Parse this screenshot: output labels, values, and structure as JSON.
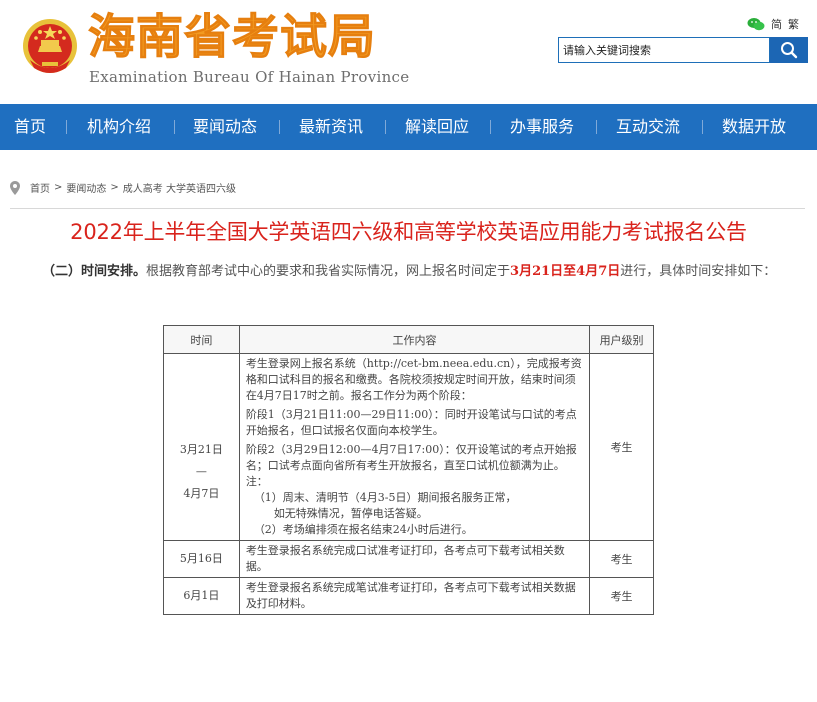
{
  "header": {
    "title_cn": "海南省考试局",
    "title_en": "Examination Bureau Of Hainan Province",
    "lang_simplified": "简",
    "lang_traditional": "繁",
    "search_placeholder": "请输入关键词搜索"
  },
  "nav": {
    "items": [
      {
        "label": "首页"
      },
      {
        "label": "机构介绍"
      },
      {
        "label": "要闻动态"
      },
      {
        "label": "最新资讯"
      },
      {
        "label": "解读回应"
      },
      {
        "label": "办事服务"
      },
      {
        "label": "互动交流"
      },
      {
        "label": "数据开放"
      }
    ]
  },
  "breadcrumb": {
    "items": [
      "首页",
      "要闻动态",
      "成人高考 大学英语四六级"
    ],
    "separator": ">"
  },
  "article": {
    "title": "2022年上半年全国大学英语四六级和高等学校英语应用能力考试报名公告",
    "para_heading": "（二）时间安排。",
    "para_text_1": "根据教育部考试中心的要求和我省实际情况，网上报名时间定于",
    "para_highlight": "3月21日至4月7日",
    "para_text_2": "进行，具体时间安排如下："
  },
  "table": {
    "headers": [
      "时间",
      "工作内容",
      "用户级别"
    ],
    "rows": [
      {
        "time_lines": [
          "3月21日",
          "—",
          "4月7日"
        ],
        "work": [
          "考生登录网上报名系统（http://cet-bm.neea.edu.cn），完成报考资格和口试科目的报名和缴费。各院校须按规定时间开放，结束时间须在4月7日17时之前。报名工作分为两个阶段：",
          "阶段1（3月21日11:00—29日11:00）：同时开设笔试与口试的考点开始报名，但口试报名仅面向本校学生。",
          "阶段2（3月29日12:00—4月7日17:00）：仅开设笔试的考点开始报名；口试考点面向省所有考生开放报名，直至口试机位额满为止。"
        ],
        "note_label": "注：",
        "notes": [
          "（1）周末、清明节（4月3-5日）期间报名服务正常，",
          "如无特殊情况，暂停电话答疑。",
          "（2）考场编排须在报名结束24小时后进行。"
        ],
        "user": "考生"
      },
      {
        "time": "5月16日",
        "work": "考生登录报名系统完成口试准考证打印，各考点可下载考试相关数据。",
        "user": "考生"
      },
      {
        "time": "6月1日",
        "work": "考生登录报名系统完成笔试准考证打印，各考点可下载考试相关数据及打印材料。",
        "user": "考生"
      }
    ]
  },
  "colors": {
    "brand_orange": "#f29a21",
    "nav_blue": "#1f6fc0",
    "title_red": "#d9231c"
  }
}
